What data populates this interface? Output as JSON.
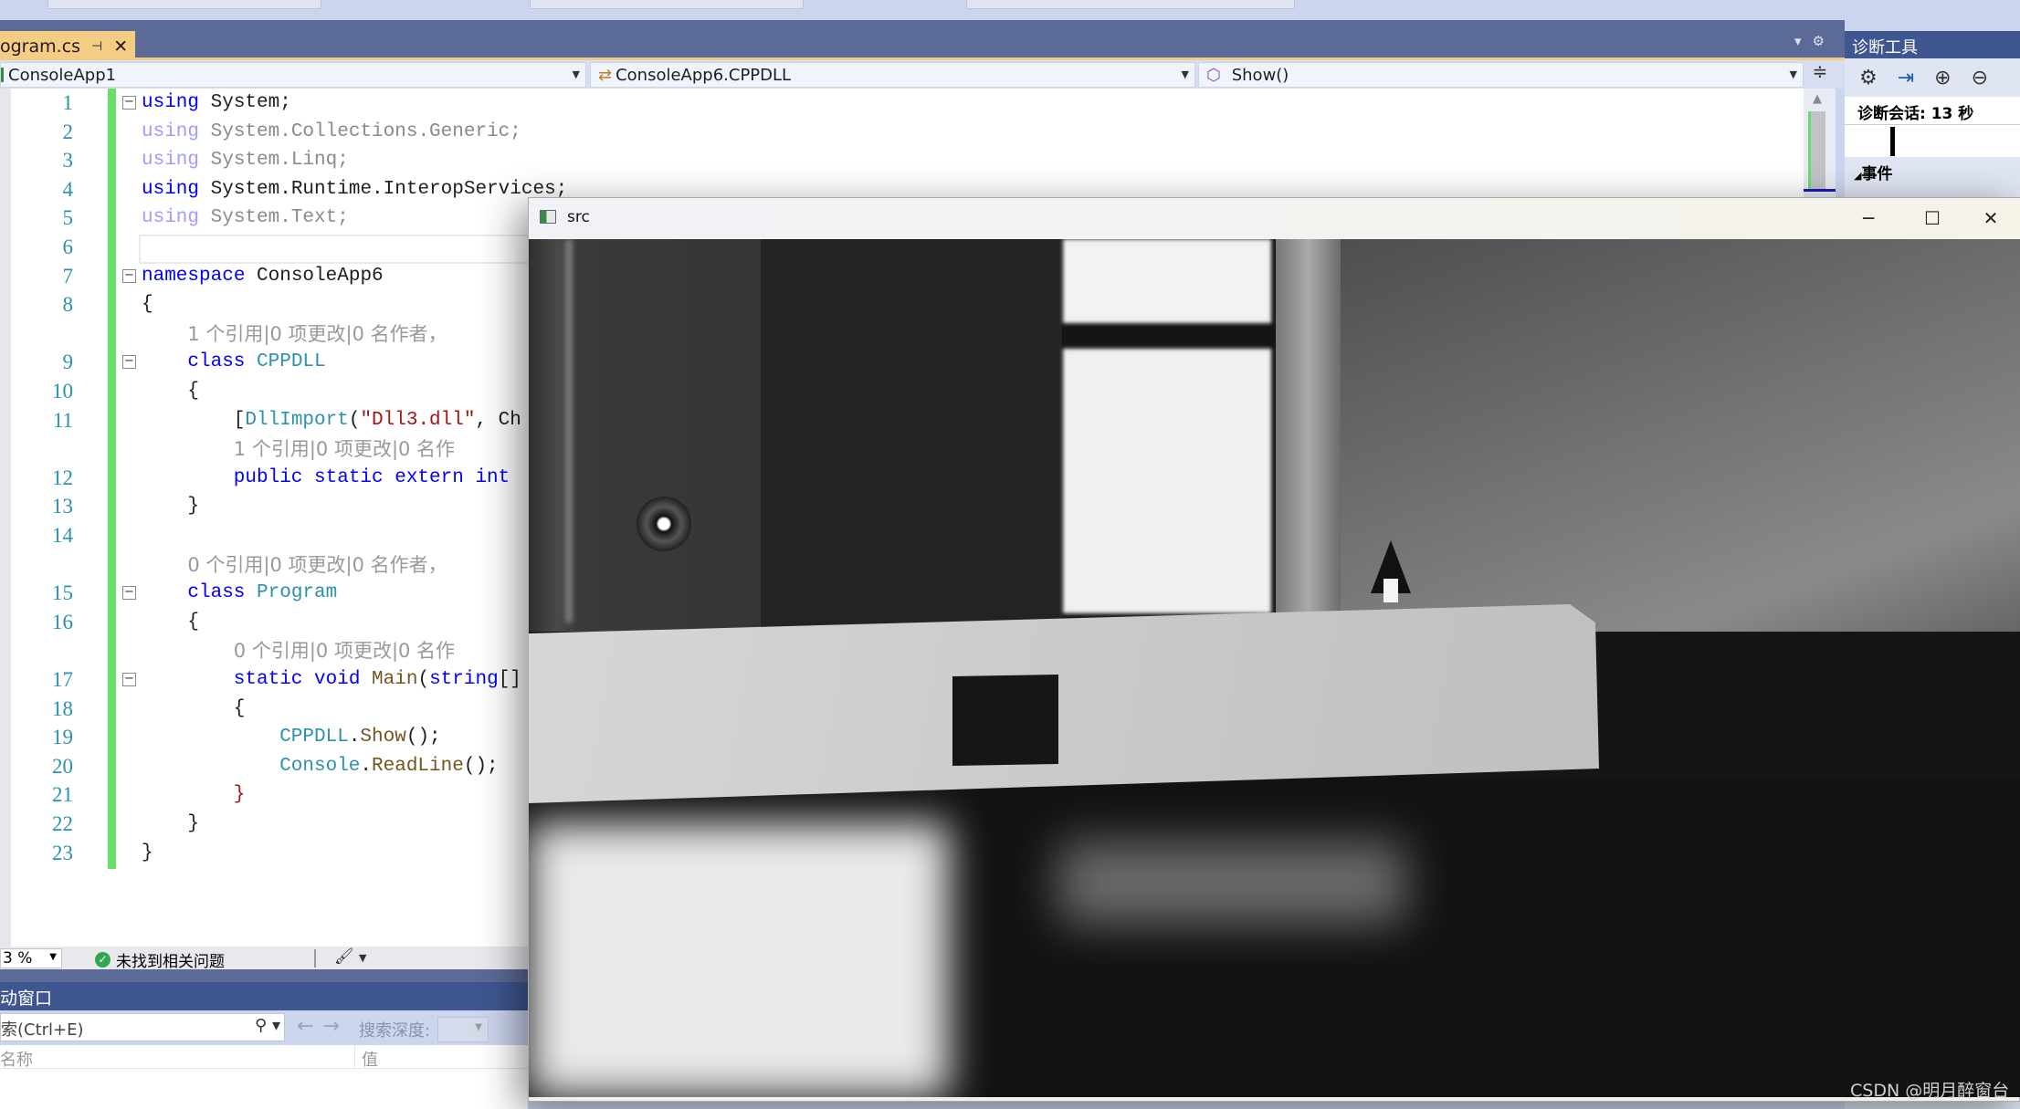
{
  "editor": {
    "tab": {
      "label": "ogram.cs",
      "pin": "⊣",
      "close": "✕"
    },
    "nav": {
      "project": "ConsoleApp1",
      "type": "ConsoleApp6.CPPDLL",
      "member": "Show()"
    },
    "rows": [
      {
        "num": "1",
        "fold": true,
        "indent": 0,
        "tokens": [
          [
            "using",
            "kw"
          ],
          [
            " System;",
            "id"
          ]
        ]
      },
      {
        "num": "2",
        "indent": 0,
        "tokens": [
          [
            "using",
            "kwf"
          ],
          [
            " System.Collections.Generic;",
            "idf"
          ]
        ]
      },
      {
        "num": "3",
        "indent": 0,
        "tokens": [
          [
            "using",
            "kwf"
          ],
          [
            " System.Linq;",
            "idf"
          ]
        ]
      },
      {
        "num": "4",
        "indent": 0,
        "tokens": [
          [
            "using",
            "kw"
          ],
          [
            " System.Runtime.InteropServices;",
            "id"
          ]
        ]
      },
      {
        "num": "5",
        "indent": 0,
        "tokens": [
          [
            "using",
            "kwf"
          ],
          [
            " System.Text;",
            "idf"
          ]
        ]
      },
      {
        "num": "6",
        "indent": 0,
        "tokens": []
      },
      {
        "num": "7",
        "fold": true,
        "indent": 0,
        "tokens": [
          [
            "namespace",
            "kw"
          ],
          [
            " ConsoleApp6",
            "id"
          ]
        ]
      },
      {
        "num": "8",
        "indent": 0,
        "tokens": [
          [
            "{",
            "id"
          ]
        ]
      },
      {
        "lens": "1 个引用|0 项更改|0 名作者，",
        "indent": 4
      },
      {
        "num": "9",
        "fold": true,
        "indent": 4,
        "tokens": [
          [
            "class",
            "kw"
          ],
          [
            " ",
            "id"
          ],
          [
            "CPPDLL",
            "ty"
          ]
        ]
      },
      {
        "num": "10",
        "indent": 4,
        "tokens": [
          [
            "{",
            "id"
          ]
        ]
      },
      {
        "num": "11",
        "indent": 8,
        "tokens": [
          [
            "[",
            "id"
          ],
          [
            "DllImport",
            "ty"
          ],
          [
            "(",
            "id"
          ],
          [
            "\"Dll3.dll\"",
            "str"
          ],
          [
            ", Ch",
            "id"
          ]
        ]
      },
      {
        "lens": "1 个引用|0 项更改|0 名作",
        "indent": 8
      },
      {
        "num": "12",
        "indent": 8,
        "tokens": [
          [
            "public static extern int",
            "kw"
          ]
        ]
      },
      {
        "num": "13",
        "indent": 4,
        "tokens": [
          [
            "}",
            "id"
          ]
        ]
      },
      {
        "num": "14",
        "indent": 0,
        "tokens": []
      },
      {
        "lens": "0 个引用|0 项更改|0 名作者，",
        "indent": 4
      },
      {
        "num": "15",
        "fold": true,
        "indent": 4,
        "tokens": [
          [
            "class",
            "kw"
          ],
          [
            " ",
            "id"
          ],
          [
            "Program",
            "ty"
          ]
        ]
      },
      {
        "num": "16",
        "indent": 4,
        "tokens": [
          [
            "{",
            "id"
          ]
        ]
      },
      {
        "lens": "0 个引用|0 项更改|0 名作",
        "indent": 8
      },
      {
        "num": "17",
        "fold": true,
        "indent": 8,
        "tokens": [
          [
            "static void",
            "kw"
          ],
          [
            " ",
            "id"
          ],
          [
            "Main",
            "me"
          ],
          [
            "(",
            "id"
          ],
          [
            "string",
            "kw"
          ],
          [
            "[]",
            "id"
          ]
        ]
      },
      {
        "num": "18",
        "indent": 8,
        "tokens": [
          [
            "{",
            "id"
          ]
        ]
      },
      {
        "num": "19",
        "indent": 12,
        "tokens": [
          [
            "CPPDLL",
            "ty"
          ],
          [
            ".",
            "id"
          ],
          [
            "Show",
            "me"
          ],
          [
            "();",
            "id"
          ]
        ]
      },
      {
        "num": "20",
        "indent": 12,
        "tokens": [
          [
            "Console",
            "ty"
          ],
          [
            ".",
            "id"
          ],
          [
            "ReadLine",
            "me"
          ],
          [
            "();",
            "id"
          ]
        ]
      },
      {
        "num": "21",
        "indent": 8,
        "tokens": [
          [
            "}",
            "str"
          ]
        ]
      },
      {
        "num": "22",
        "indent": 4,
        "tokens": [
          [
            "}",
            "id"
          ]
        ]
      },
      {
        "num": "23",
        "indent": 0,
        "tokens": [
          [
            "}",
            "id"
          ]
        ]
      }
    ]
  },
  "colors": {
    "kw": "#0000ff",
    "kwf": "#9d9dff",
    "id": "#1e1e1e",
    "idf": "#8a8a8a",
    "ty": "#2b91af",
    "str": "#a31515",
    "me": "#74531f",
    "accent": "#5b6a96",
    "tab_active": "#f5cc84"
  },
  "diagnostics": {
    "title": "诊断工具",
    "session": "诊断会话: 13 秒",
    "events": "事件",
    "icons": [
      "gear-icon",
      "export-icon",
      "zoom-in-icon",
      "zoom-out-icon"
    ]
  },
  "status": {
    "zoom": "3 %",
    "issues": "未找到相关问题"
  },
  "autos": {
    "title": "动窗口",
    "search_placeholder": "搜索(Ctrl+E)",
    "depth_label": "搜索深度:",
    "columns": [
      "名称",
      "值"
    ]
  },
  "src_window": {
    "title": "src",
    "minimize": "─",
    "maximize": "☐",
    "close": "✕"
  },
  "watermark": "CSDN @明月醉窗台"
}
